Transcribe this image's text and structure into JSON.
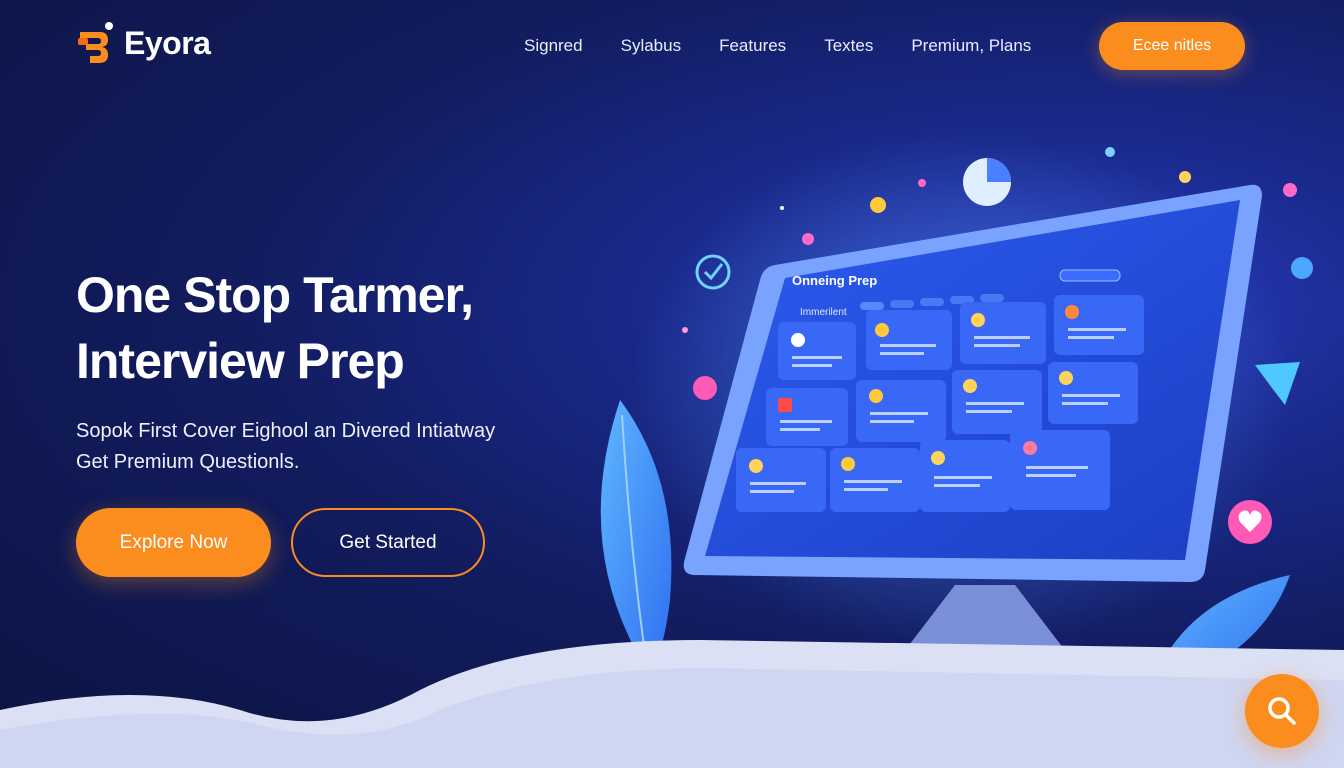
{
  "brand": {
    "name": "Eyora"
  },
  "nav": {
    "links": [
      "Signred",
      "Sylabus",
      "Features",
      "Textes",
      "Premium, Plans"
    ],
    "cta": "Ecee nitles"
  },
  "hero": {
    "title_line1": "One Stop Tarmer,",
    "title_line2": "Interview Prep",
    "sub_line1": "Sopok First Cover Eighool an Divered Intiatway",
    "sub_line2": "Get Premium Questionls.",
    "primary_btn": "Explore Now",
    "secondary_btn": "Get Started"
  },
  "monitor": {
    "header": "Onneing Prep",
    "tab": "Immerilent"
  },
  "icons": {
    "logo": "eyora-logo-icon",
    "search": "search-icon",
    "check": "check-circle-icon",
    "heart": "heart-icon",
    "chart": "pie-chart-icon",
    "plane": "paper-plane-icon"
  },
  "colors": {
    "accent": "#fb8c1e",
    "bg_dark": "#0c1440",
    "bg_mid": "#1a2a8e",
    "screen": "#2550e0"
  }
}
